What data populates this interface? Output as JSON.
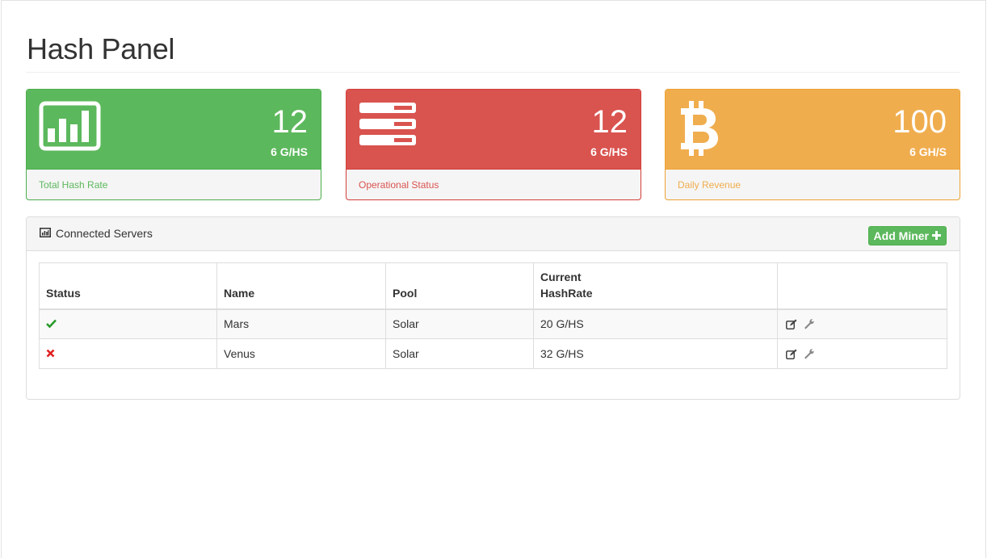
{
  "page": {
    "title": "Hash Panel"
  },
  "stats": [
    {
      "value": "12",
      "sub": "6 G/HS",
      "label": "Total Hash Rate",
      "color": "#5cb85c",
      "icon": "bar-chart-icon"
    },
    {
      "value": "12",
      "sub": "6 G/HS",
      "label": "Operational Status",
      "color": "#d9534f",
      "icon": "server-icon"
    },
    {
      "value": "100",
      "sub": "6 GH/S",
      "label": "Daily Revenue",
      "color": "#f0ad4e",
      "icon": "bitcoin-icon"
    }
  ],
  "servers": {
    "title": "Connected Servers",
    "title_icon": "bar-chart-icon",
    "add_label": "Add Miner",
    "add_icon": "plus-icon",
    "columns": [
      "Status",
      "Name",
      "Pool",
      "Current HashRate",
      ""
    ],
    "rows": [
      {
        "status": "online",
        "status_icon": "check-icon",
        "name": "Mars",
        "pool": "Solar",
        "hashrate": "20 G/HS"
      },
      {
        "status": "offline",
        "status_icon": "cross-icon",
        "name": "Venus",
        "pool": "Solar",
        "hashrate": "32 G/HS"
      }
    ],
    "row_actions": [
      "edit-icon",
      "wrench-icon"
    ]
  }
}
